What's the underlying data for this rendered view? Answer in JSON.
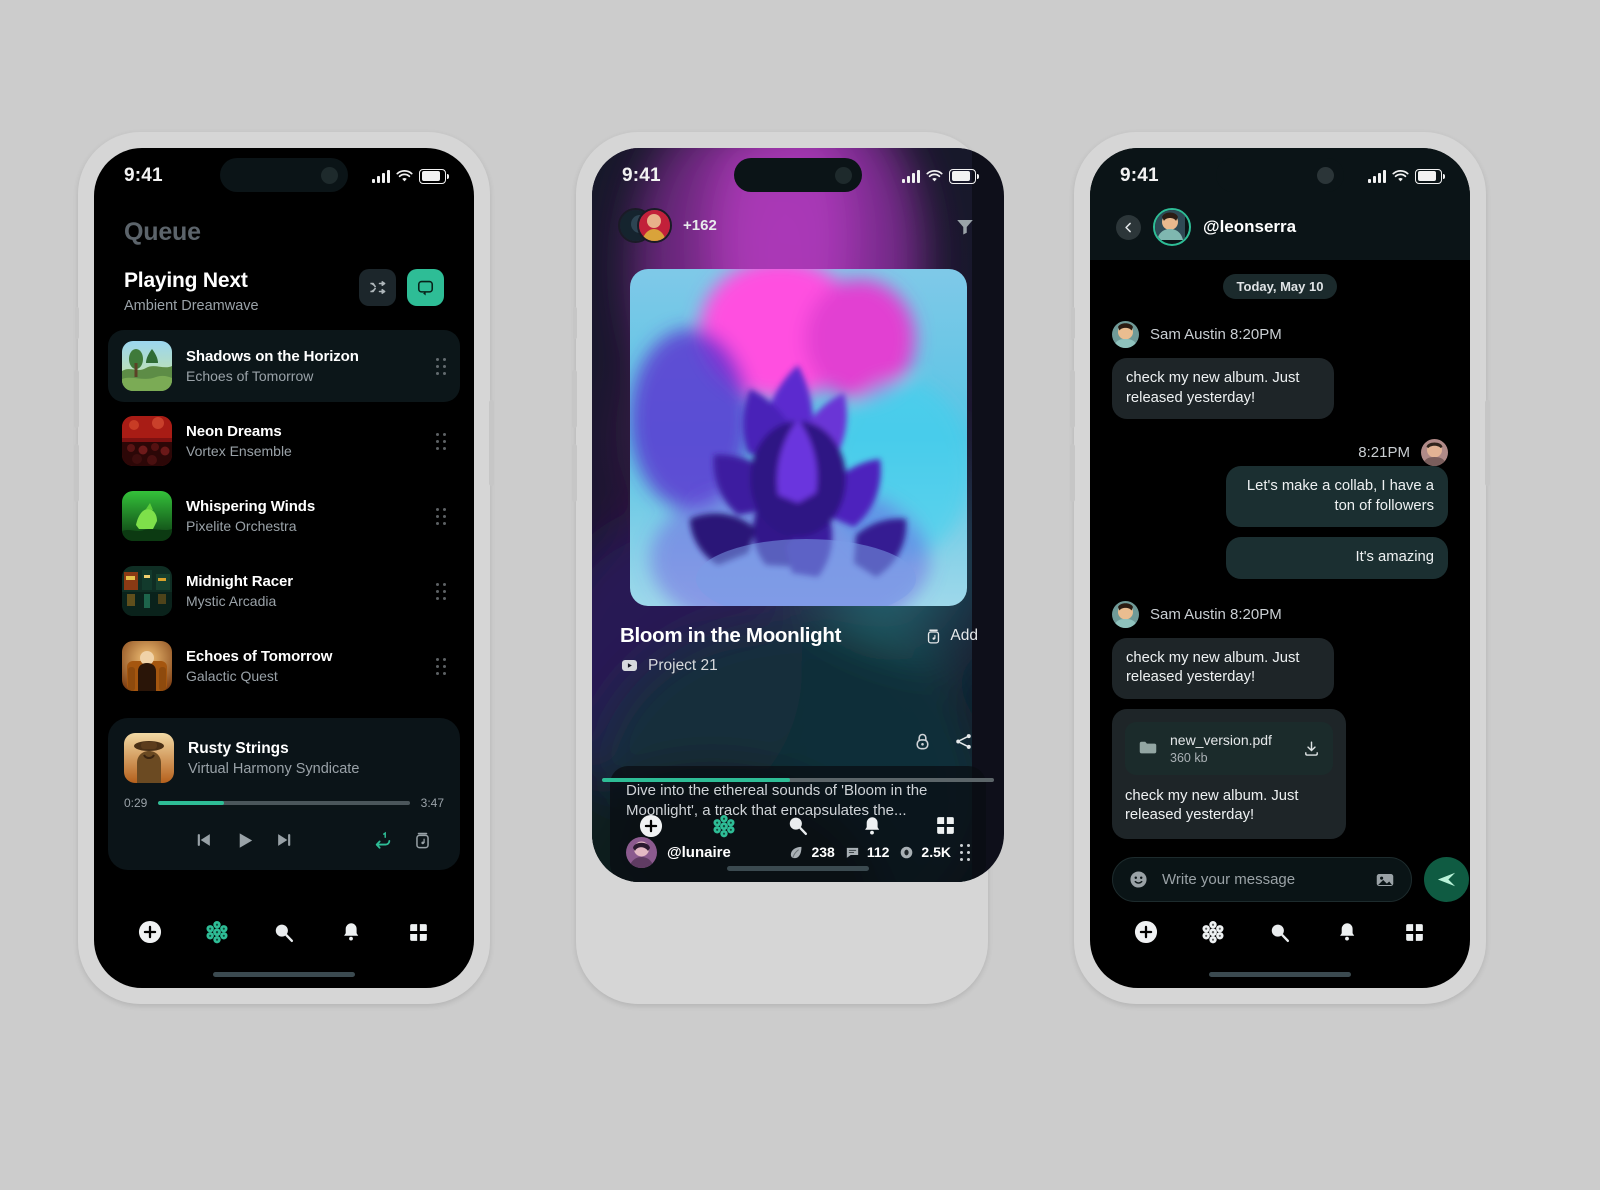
{
  "theme": {
    "page_bg": "#cccccc",
    "frame": "#d6d6d6",
    "screen_bg": "#000000",
    "accent": "#2ebd96",
    "accent_dark": "#0f5b42",
    "text_primary": "#ffffff",
    "text_muted": "#9aa2a8"
  },
  "status_bar": {
    "time": "9:41",
    "signal": "cellular-bars",
    "wifi": "wifi-icon",
    "battery": "battery-icon"
  },
  "bottom_nav": {
    "items": [
      {
        "name": "add",
        "icon": "plus-circle-icon",
        "active": false
      },
      {
        "name": "home",
        "icon": "flower-cluster-icon",
        "active": true
      },
      {
        "name": "search",
        "icon": "search-icon",
        "active": false
      },
      {
        "name": "notifications",
        "icon": "bell-icon",
        "active": false
      },
      {
        "name": "apps",
        "icon": "grid-clover-icon",
        "active": false
      }
    ]
  },
  "phone1": {
    "screen_title": "Queue",
    "section": {
      "title": "Playing Next",
      "subtitle": "Ambient Dreamwave"
    },
    "controls": [
      {
        "name": "shuffle",
        "icon": "shuffle-icon",
        "active": false
      },
      {
        "name": "repeat",
        "icon": "repeat-icon",
        "active": true
      }
    ],
    "tracks": [
      {
        "title": "Shadows on the Horizon",
        "artist": "Echoes of Tomorrow",
        "active": true,
        "art": {
          "type": "landscape",
          "c1": "#8fd0ea",
          "c2": "#6f9b4e",
          "c3": "#c9e07a"
        }
      },
      {
        "title": "Neon Dreams",
        "artist": "Vortex Ensemble",
        "active": false,
        "art": {
          "type": "crowd",
          "c1": "#8c1414",
          "c2": "#d33a2a",
          "c3": "#3a0a0a"
        }
      },
      {
        "title": "Whispering Winds",
        "artist": "Pixelite Orchestra",
        "active": false,
        "art": {
          "type": "creature",
          "c1": "#1f8f2a",
          "c2": "#6ee04a",
          "c3": "#0d3d12"
        }
      },
      {
        "title": "Midnight Racer",
        "artist": "Mystic Arcadia",
        "active": false,
        "art": {
          "type": "city",
          "c1": "#0f3a2c",
          "c2": "#d9a22b",
          "c3": "#7a2f14"
        }
      },
      {
        "title": "Echoes of Tomorrow",
        "artist": "Galactic Quest",
        "active": false,
        "art": {
          "type": "portrait",
          "c1": "#c8761f",
          "c2": "#f0c070",
          "c3": "#3a1b08"
        }
      }
    ],
    "player": {
      "title": "Rusty Strings",
      "artist": "Virtual Harmony Syndicate",
      "time_elapsed": "0:29",
      "time_total": "3:47",
      "progress_percent": 26,
      "buttons": [
        {
          "name": "previous",
          "icon": "skip-previous-icon"
        },
        {
          "name": "play",
          "icon": "play-icon"
        },
        {
          "name": "next",
          "icon": "skip-next-icon"
        },
        {
          "name": "repeat-one",
          "icon": "repeat-one-icon"
        },
        {
          "name": "save-to-library",
          "icon": "save-track-icon"
        }
      ]
    }
  },
  "phone2": {
    "participants_count": "+162",
    "filter_icon": "filter-funnel-icon",
    "post": {
      "title": "Bloom in the Moonlight",
      "add_label": "Add",
      "add_icon": "add-track-icon",
      "project_label": "Project 21",
      "project_icon": "video-icon",
      "description": "Dive into the ethereal sounds of 'Bloom in the Moonlight', a track that encapsulates the...",
      "author": "@lunaire",
      "actions": [
        {
          "name": "lock",
          "icon": "lock-icon"
        },
        {
          "name": "share",
          "icon": "share-icon"
        }
      ],
      "stats": [
        {
          "name": "likes",
          "icon": "leaf-icon",
          "value": "238"
        },
        {
          "name": "comments",
          "icon": "comment-icon",
          "value": "112"
        },
        {
          "name": "views",
          "icon": "eye-icon",
          "value": "2.5K"
        }
      ],
      "more_icon": "drag-grid-icon",
      "progress_percent": 48
    }
  },
  "phone3": {
    "header": {
      "back_icon": "chevron-left-icon",
      "username": "@leonserra"
    },
    "day_divider": "Today, May 10",
    "messages": [
      {
        "kind": "incoming-header",
        "sender": "Sam Austin 8:20PM"
      },
      {
        "kind": "incoming",
        "text": "check my new album. Just released yesterday!"
      },
      {
        "kind": "outgoing-header",
        "time": "8:21PM"
      },
      {
        "kind": "outgoing",
        "text": "Let's make a collab, I have a ton of followers"
      },
      {
        "kind": "outgoing",
        "text": "It's amazing"
      },
      {
        "kind": "incoming-header",
        "sender": "Sam Austin 8:20PM"
      },
      {
        "kind": "incoming",
        "text": "check my new album. Just released yesterday!"
      },
      {
        "kind": "incoming-file",
        "file_name": "new_version.pdf",
        "file_size": "360 kb",
        "file_icon": "folder-icon",
        "download_icon": "download-icon",
        "caption": "check my new album. Just released yesterday!"
      }
    ],
    "composer": {
      "emoji_icon": "emoji-smiley-icon",
      "placeholder": "Write your message",
      "value": "",
      "image_icon": "image-icon",
      "send_icon": "send-icon"
    }
  }
}
